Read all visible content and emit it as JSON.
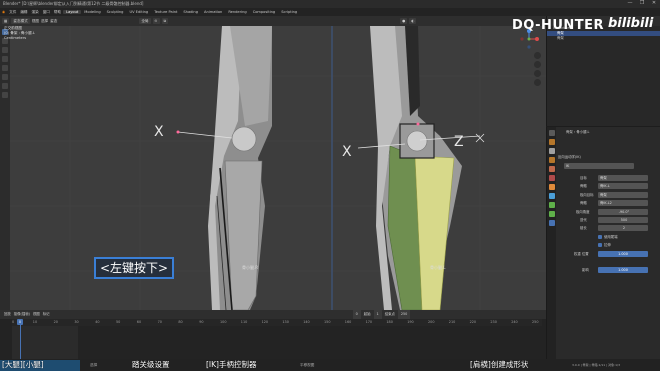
{
  "window": {
    "title": "Blender* [D:\\星辉\\blender绑定从入门到精通\\第12节 二级骨骼控制器.blend]",
    "controls": [
      "—",
      "❐",
      "✕"
    ]
  },
  "menu": {
    "items": [
      "文件",
      "编辑",
      "渲染",
      "窗口",
      "帮助"
    ],
    "workspaces": [
      "Layout",
      "Modeling",
      "Sculpting",
      "UV Editing",
      "Texture Paint",
      "Shading",
      "Animation",
      "Rendering",
      "Compositing",
      "Scripting"
    ],
    "active_workspace": "Layout",
    "scene_label": "Scene",
    "viewlayer_label": "View Layer"
  },
  "viewport": {
    "mode": "姿态模式",
    "header_items": [
      "视图",
      "选择",
      "姿态"
    ],
    "transform": "全局",
    "info_lines": [
      "正交前视图",
      "(0) 骨架 : 骨小腿.L",
      "Centimeters"
    ],
    "bone_labels": [
      "骨小腿.R",
      "骨小腿.L"
    ],
    "empty_markers": [
      "X",
      "X",
      "Z"
    ],
    "caption": "<左键按下>"
  },
  "overlay": {
    "title": "DQ-HUNTER",
    "logo": "bilibili"
  },
  "outliner": {
    "rows": [
      {
        "label": "Collection",
        "selected": false
      },
      {
        "label": "骨架",
        "selected": true
      },
      {
        "label": "骨架",
        "selected": false
      }
    ]
  },
  "properties": {
    "breadcrumb": "骨架 › 骨小腿.L",
    "section_title": "反向运动学(IK)",
    "constraint_name": "IK",
    "fields": [
      {
        "label": "目标",
        "value": "骨架"
      },
      {
        "label": "骨骼",
        "value": "骨IK.L"
      },
      {
        "label": "极向目标",
        "value": "骨架"
      },
      {
        "label": "骨骼",
        "value": "骨IK.L2"
      },
      {
        "label": "极向角度",
        "value": "-90.0°"
      },
      {
        "label": "迭代",
        "value": "500"
      },
      {
        "label": "链长",
        "value": "2"
      }
    ],
    "checks": [
      {
        "label": "使用尾端",
        "checked": true
      },
      {
        "label": "拉伸",
        "checked": true
      }
    ],
    "weight_label": "权重 位置",
    "weight_value": "1.000",
    "influence_label": "影响",
    "influence_value": "1.000"
  },
  "timeline": {
    "menu": [
      "回放",
      "抠像(插帧)",
      "视图",
      "标记"
    ],
    "current_frame": "0",
    "start_label": "起始",
    "start": "1",
    "end_label": "结束点",
    "end": "250",
    "ticks": [
      "0",
      "10",
      "20",
      "30",
      "40",
      "50",
      "60",
      "70",
      "80",
      "90",
      "100",
      "110",
      "120",
      "130",
      "140",
      "150",
      "160",
      "170",
      "180",
      "190",
      "200",
      "210",
      "220",
      "230",
      "240",
      "250"
    ]
  },
  "status": {
    "left": "选择",
    "mid": "平移视图",
    "right": "3.0.0 | 骨架 | 骨骼:1/11 | 对象:1/3"
  },
  "subtitles": [
    "[大腿][小腿]",
    "踏关级设置",
    "[IK]手柄控制器",
    "[肩横]创建成形状"
  ],
  "colors": {
    "accent": "#4772b3",
    "selected_bone": "#7d9a52",
    "yellow_bone": "#d7d98a",
    "caption_border": "#3a7fd6"
  }
}
